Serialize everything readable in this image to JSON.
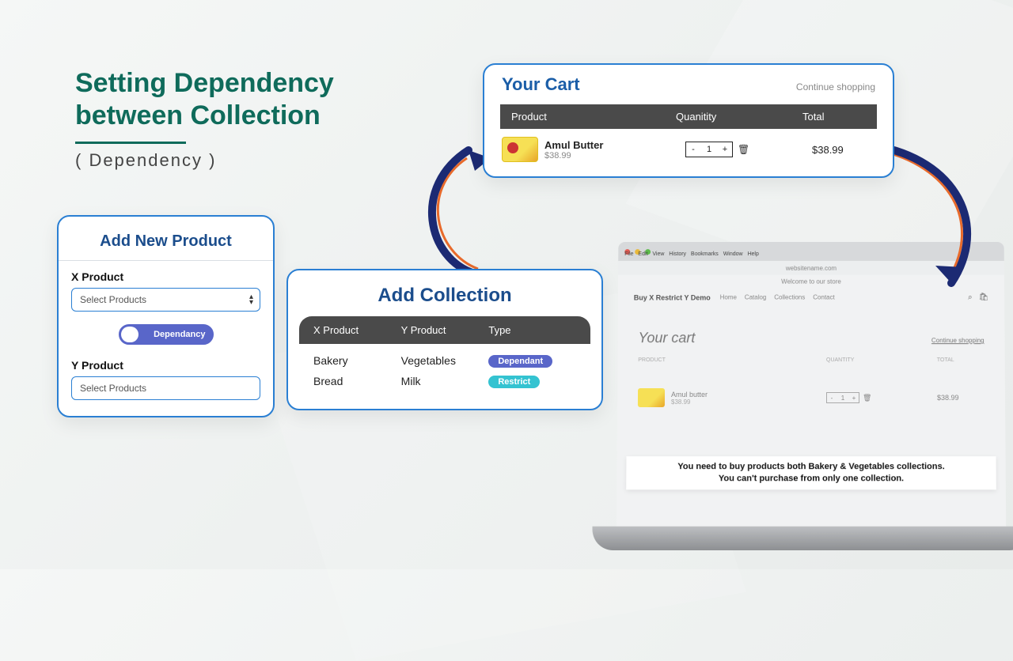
{
  "heading": {
    "line1": "Setting Dependency",
    "line2": "between Collection",
    "subtitle": "( Dependency )"
  },
  "product_form": {
    "title": "Add New Product",
    "x_label": "X Product",
    "x_placeholder": "Select Products",
    "toggle_label": "Dependancy",
    "y_label": "Y Product",
    "y_placeholder": "Select Products"
  },
  "collection": {
    "title": "Add Collection",
    "columns": {
      "x": "X Product",
      "y": "Y Product",
      "type": "Type"
    },
    "rows": [
      {
        "x": "Bakery",
        "y": "Vegetables",
        "type": "Dependant",
        "badge": "badge-dep"
      },
      {
        "x": "Bread",
        "y": "Milk",
        "type": "Restrict",
        "badge": "badge-res"
      }
    ]
  },
  "cart": {
    "title": "Your Cart",
    "continue": "Continue shopping",
    "columns": {
      "product": "Product",
      "qty": "Quanitity",
      "total": "Total"
    },
    "item": {
      "name": "Amul Butter",
      "price": "$38.99",
      "qty": "1",
      "total": "$38.99"
    }
  },
  "laptop": {
    "menubar": [
      "File",
      "Edit",
      "View",
      "History",
      "Bookmarks",
      "Window",
      "Help"
    ],
    "address": "websitename.com",
    "welcome": "Welcome to our store",
    "brand": "Buy X Restrict Y Demo",
    "nav": [
      "Home",
      "Catalog",
      "Collections",
      "Contact"
    ],
    "cart_title": "Your cart",
    "continue": "Continue shopping",
    "thead": {
      "product": "PRODUCT",
      "qty": "QUANTITY",
      "total": "TOTAL"
    },
    "row": {
      "name": "Amul butter",
      "price": "$38.99",
      "qty": "1",
      "total": "$38.99"
    },
    "banner_line1": "You need to buy products both Bakery & Vegetables collections.",
    "banner_line2": "You can't purchase from only one collection."
  },
  "colors": {
    "primary_green": "#0f6b5b",
    "primary_blue": "#1b5ea8",
    "border_blue": "#2a7fd3",
    "toggle_purple": "#5966c9",
    "restrict_teal": "#34c3d1"
  }
}
